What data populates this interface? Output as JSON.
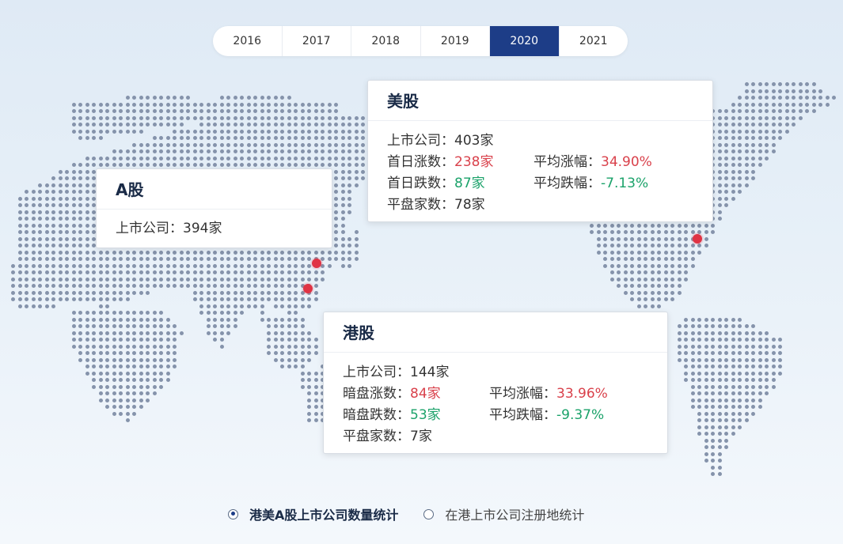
{
  "year_tabs": [
    {
      "label": "2016",
      "active": false
    },
    {
      "label": "2017",
      "active": false
    },
    {
      "label": "2018",
      "active": false
    },
    {
      "label": "2019",
      "active": false
    },
    {
      "label": "2020",
      "active": true
    },
    {
      "label": "2021",
      "active": false
    }
  ],
  "cards": {
    "a_share": {
      "title": "A股",
      "listed_label": "上市公司：",
      "listed_value": "394家"
    },
    "us_share": {
      "title": "美股",
      "listed_label": "上市公司：",
      "listed_value": "403家",
      "up_label": "首日涨数：",
      "up_value": "238家",
      "avg_rise_label": "平均涨幅：",
      "avg_rise_value": "34.90%",
      "down_label": "首日跌数：",
      "down_value": "87家",
      "avg_fall_label": "平均跌幅：",
      "avg_fall_value": "-7.13%",
      "flat_label": "平盘家数：",
      "flat_value": "78家"
    },
    "hk_share": {
      "title": "港股",
      "listed_label": "上市公司：",
      "listed_value": "144家",
      "up_label": "暗盘涨数：",
      "up_value": "84家",
      "avg_rise_label": "平均涨幅：",
      "avg_rise_value": "33.96%",
      "down_label": "暗盘跌数：",
      "down_value": "53家",
      "avg_fall_label": "平均跌幅：",
      "avg_fall_value": "-9.37%",
      "flat_label": "平盘家数：",
      "flat_value": "7家"
    }
  },
  "radios": [
    {
      "label": "港美A股上市公司数量统计",
      "checked": true
    },
    {
      "label": "在港上市公司注册地统计",
      "checked": false
    }
  ],
  "colors": {
    "accent": "#1d3d87",
    "up": "#d9414b",
    "down": "#1ba26a",
    "marker": "#e03344"
  }
}
